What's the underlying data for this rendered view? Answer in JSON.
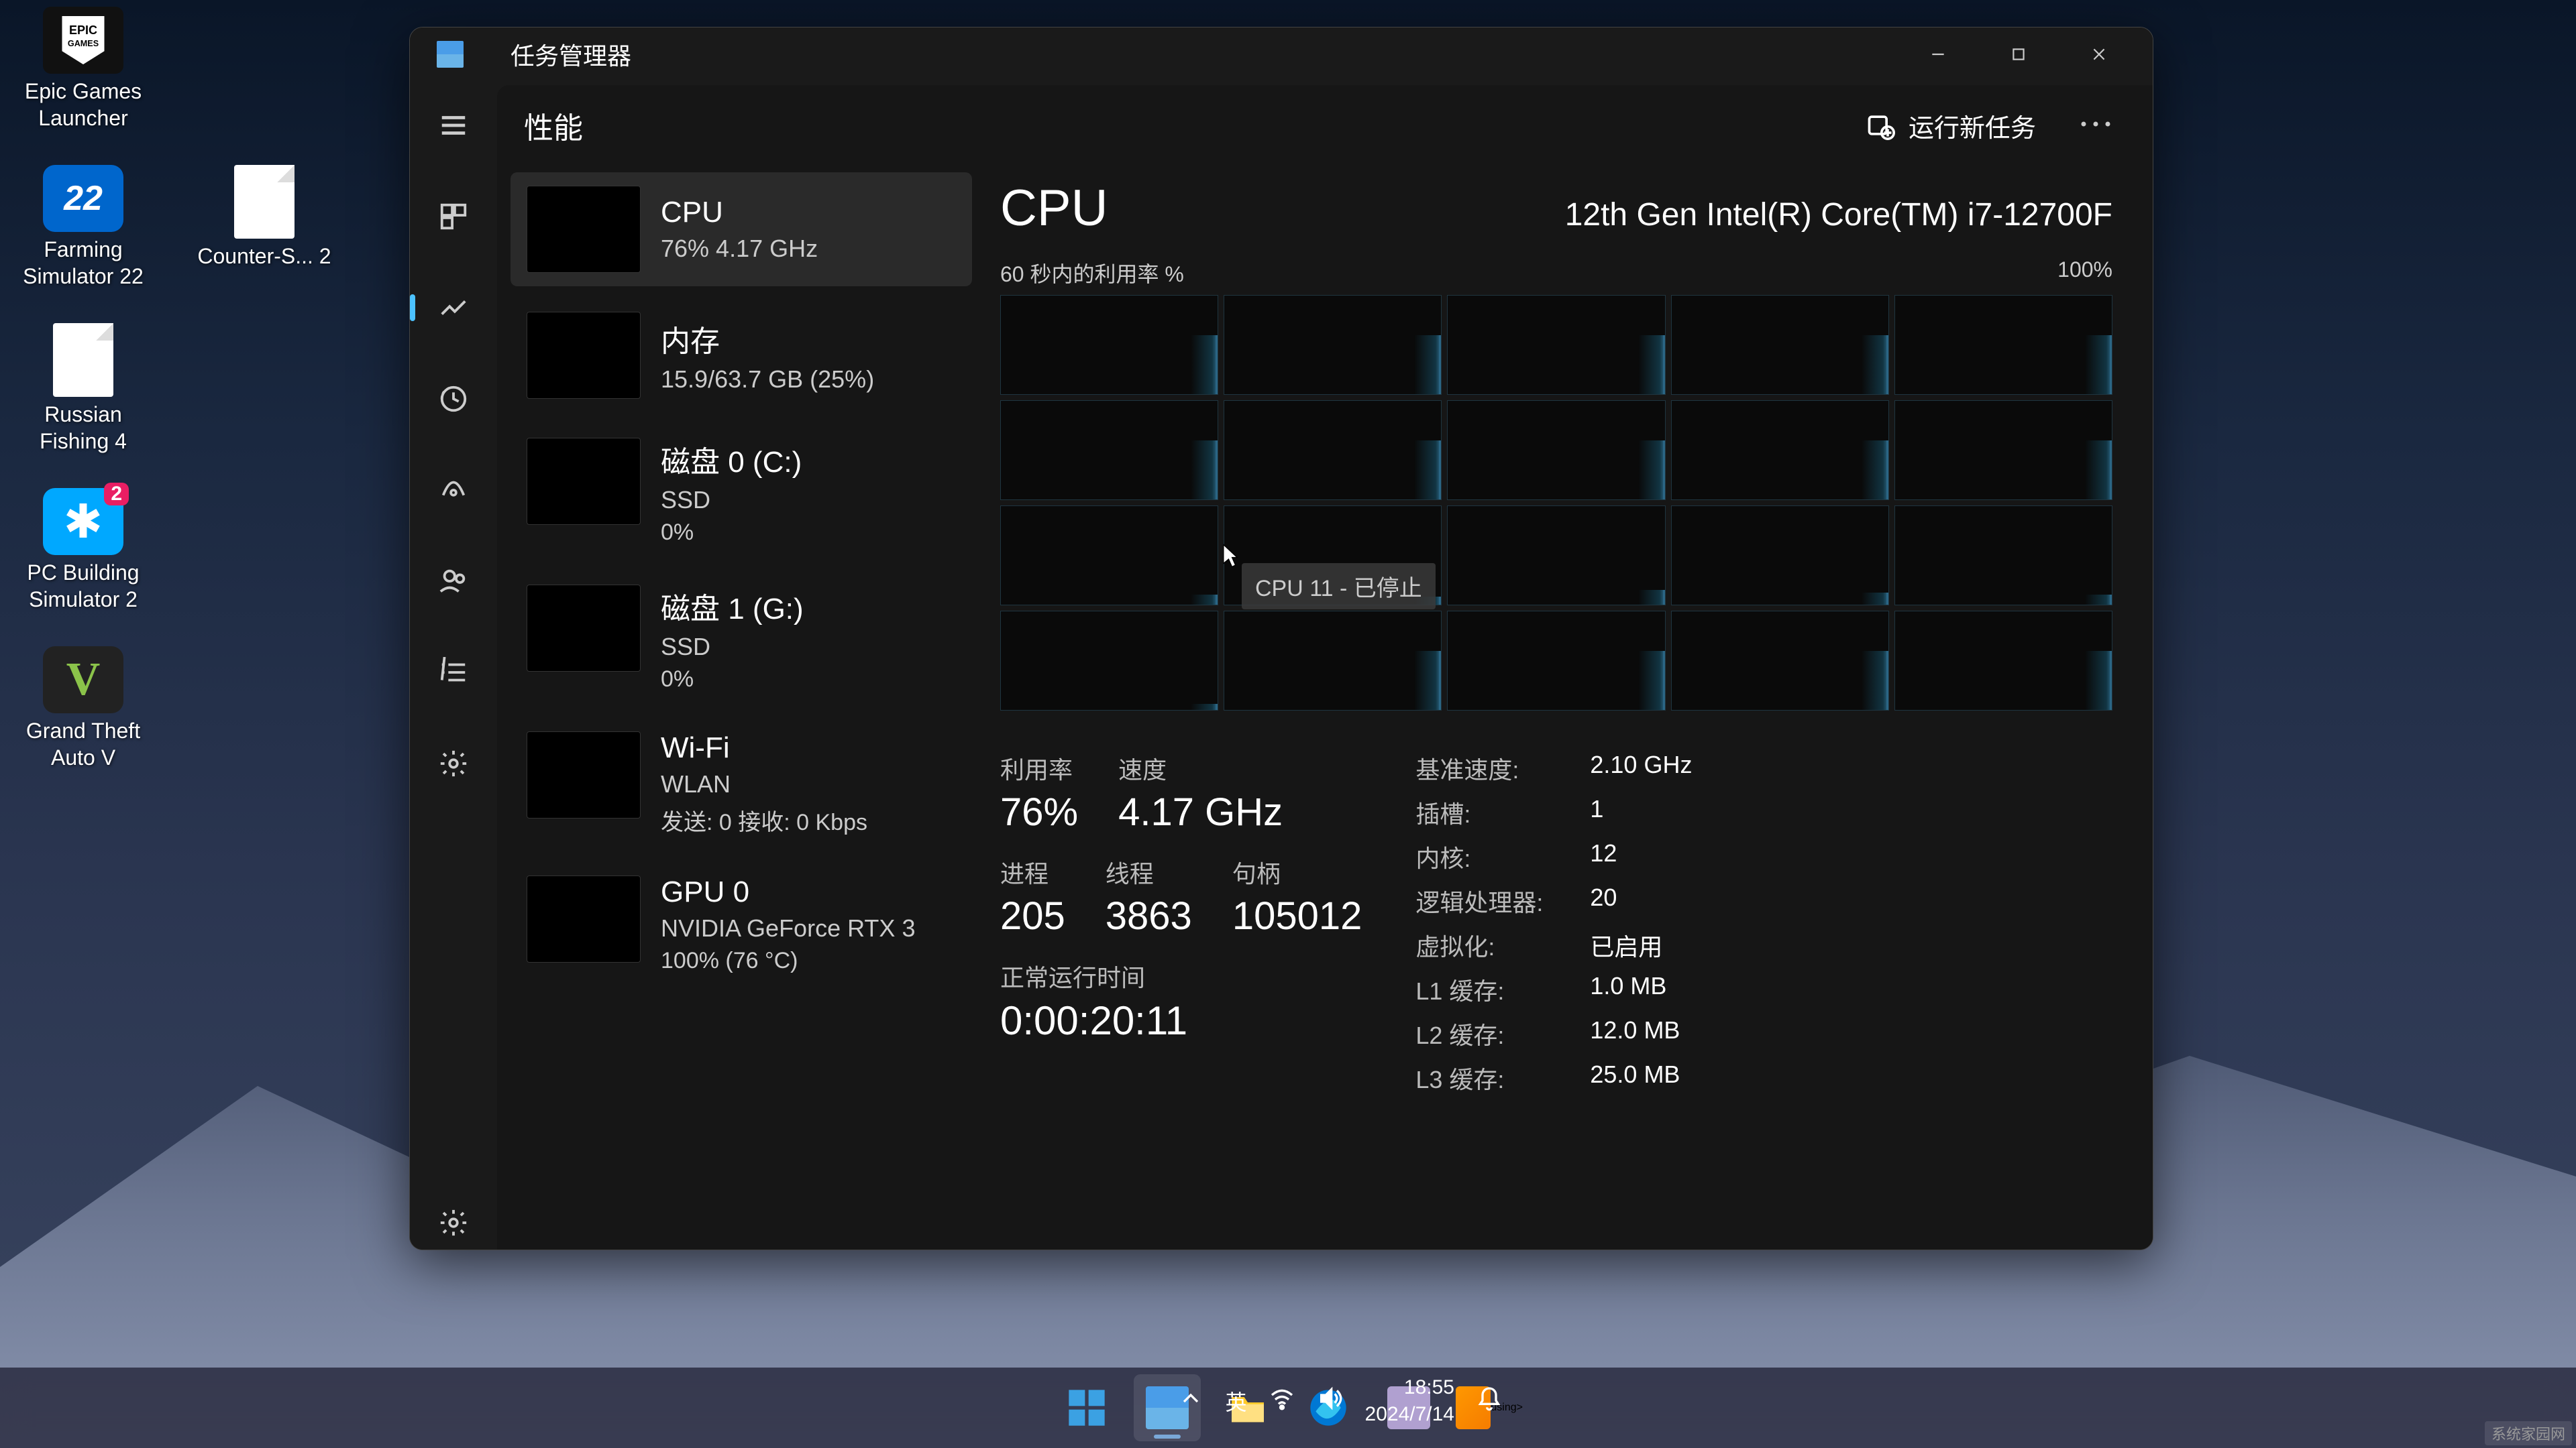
{
  "desktop": {
    "icons": [
      {
        "label": "Epic Games Launcher"
      },
      {
        "label": "Farming Simulator 22"
      },
      {
        "label": "Counter-S... 2"
      },
      {
        "label": "Russian Fishing 4"
      },
      {
        "label": "PC Building Simulator 2"
      },
      {
        "label": "Grand Theft Auto V"
      }
    ]
  },
  "taskmgr": {
    "title": "任务管理器",
    "topbar": {
      "heading": "性能",
      "run_task": "运行新任务"
    },
    "sidelist": [
      {
        "name": "CPU",
        "sub": "76%  4.17 GHz"
      },
      {
        "name": "内存",
        "sub": "15.9/63.7 GB (25%)"
      },
      {
        "name": "磁盘 0 (C:)",
        "sub": "SSD",
        "sub2": "0%"
      },
      {
        "name": "磁盘 1 (G:)",
        "sub": "SSD",
        "sub2": "0%"
      },
      {
        "name": "Wi-Fi",
        "sub": "WLAN",
        "sub2": "发送: 0 接收: 0 Kbps"
      },
      {
        "name": "GPU 0",
        "sub": "NVIDIA GeForce RTX 3",
        "sub2": "100% (76 °C)"
      }
    ],
    "detail": {
      "title": "CPU",
      "model": "12th Gen Intel(R) Core(TM) i7-12700F",
      "chart_label_left": "60 秒内的利用率 %",
      "chart_label_right": "100%",
      "tooltip": "CPU 11 - 已停止",
      "stats": {
        "util_label": "利用率",
        "util": "76%",
        "speed_label": "速度",
        "speed": "4.17 GHz",
        "proc_label": "进程",
        "proc": "205",
        "thread_label": "线程",
        "thread": "3863",
        "handle_label": "句柄",
        "handle": "105012",
        "uptime_label": "正常运行时间",
        "uptime": "0:00:20:11"
      },
      "kv": [
        {
          "k": "基准速度:",
          "v": "2.10 GHz"
        },
        {
          "k": "插槽:",
          "v": "1"
        },
        {
          "k": "内核:",
          "v": "12"
        },
        {
          "k": "逻辑处理器:",
          "v": "20"
        },
        {
          "k": "虚拟化:",
          "v": "已启用"
        },
        {
          "k": "L1 缓存:",
          "v": "1.0 MB"
        },
        {
          "k": "L2 缓存:",
          "v": "12.0 MB"
        },
        {
          "k": "L3 缓存:",
          "v": "25.0 MB"
        }
      ]
    }
  },
  "taskbar": {
    "ime": "英",
    "time": "18:55",
    "date": "2024/7/14"
  },
  "watermark": "系统家园网",
  "colors": {
    "accent": "#4cc2ff"
  }
}
